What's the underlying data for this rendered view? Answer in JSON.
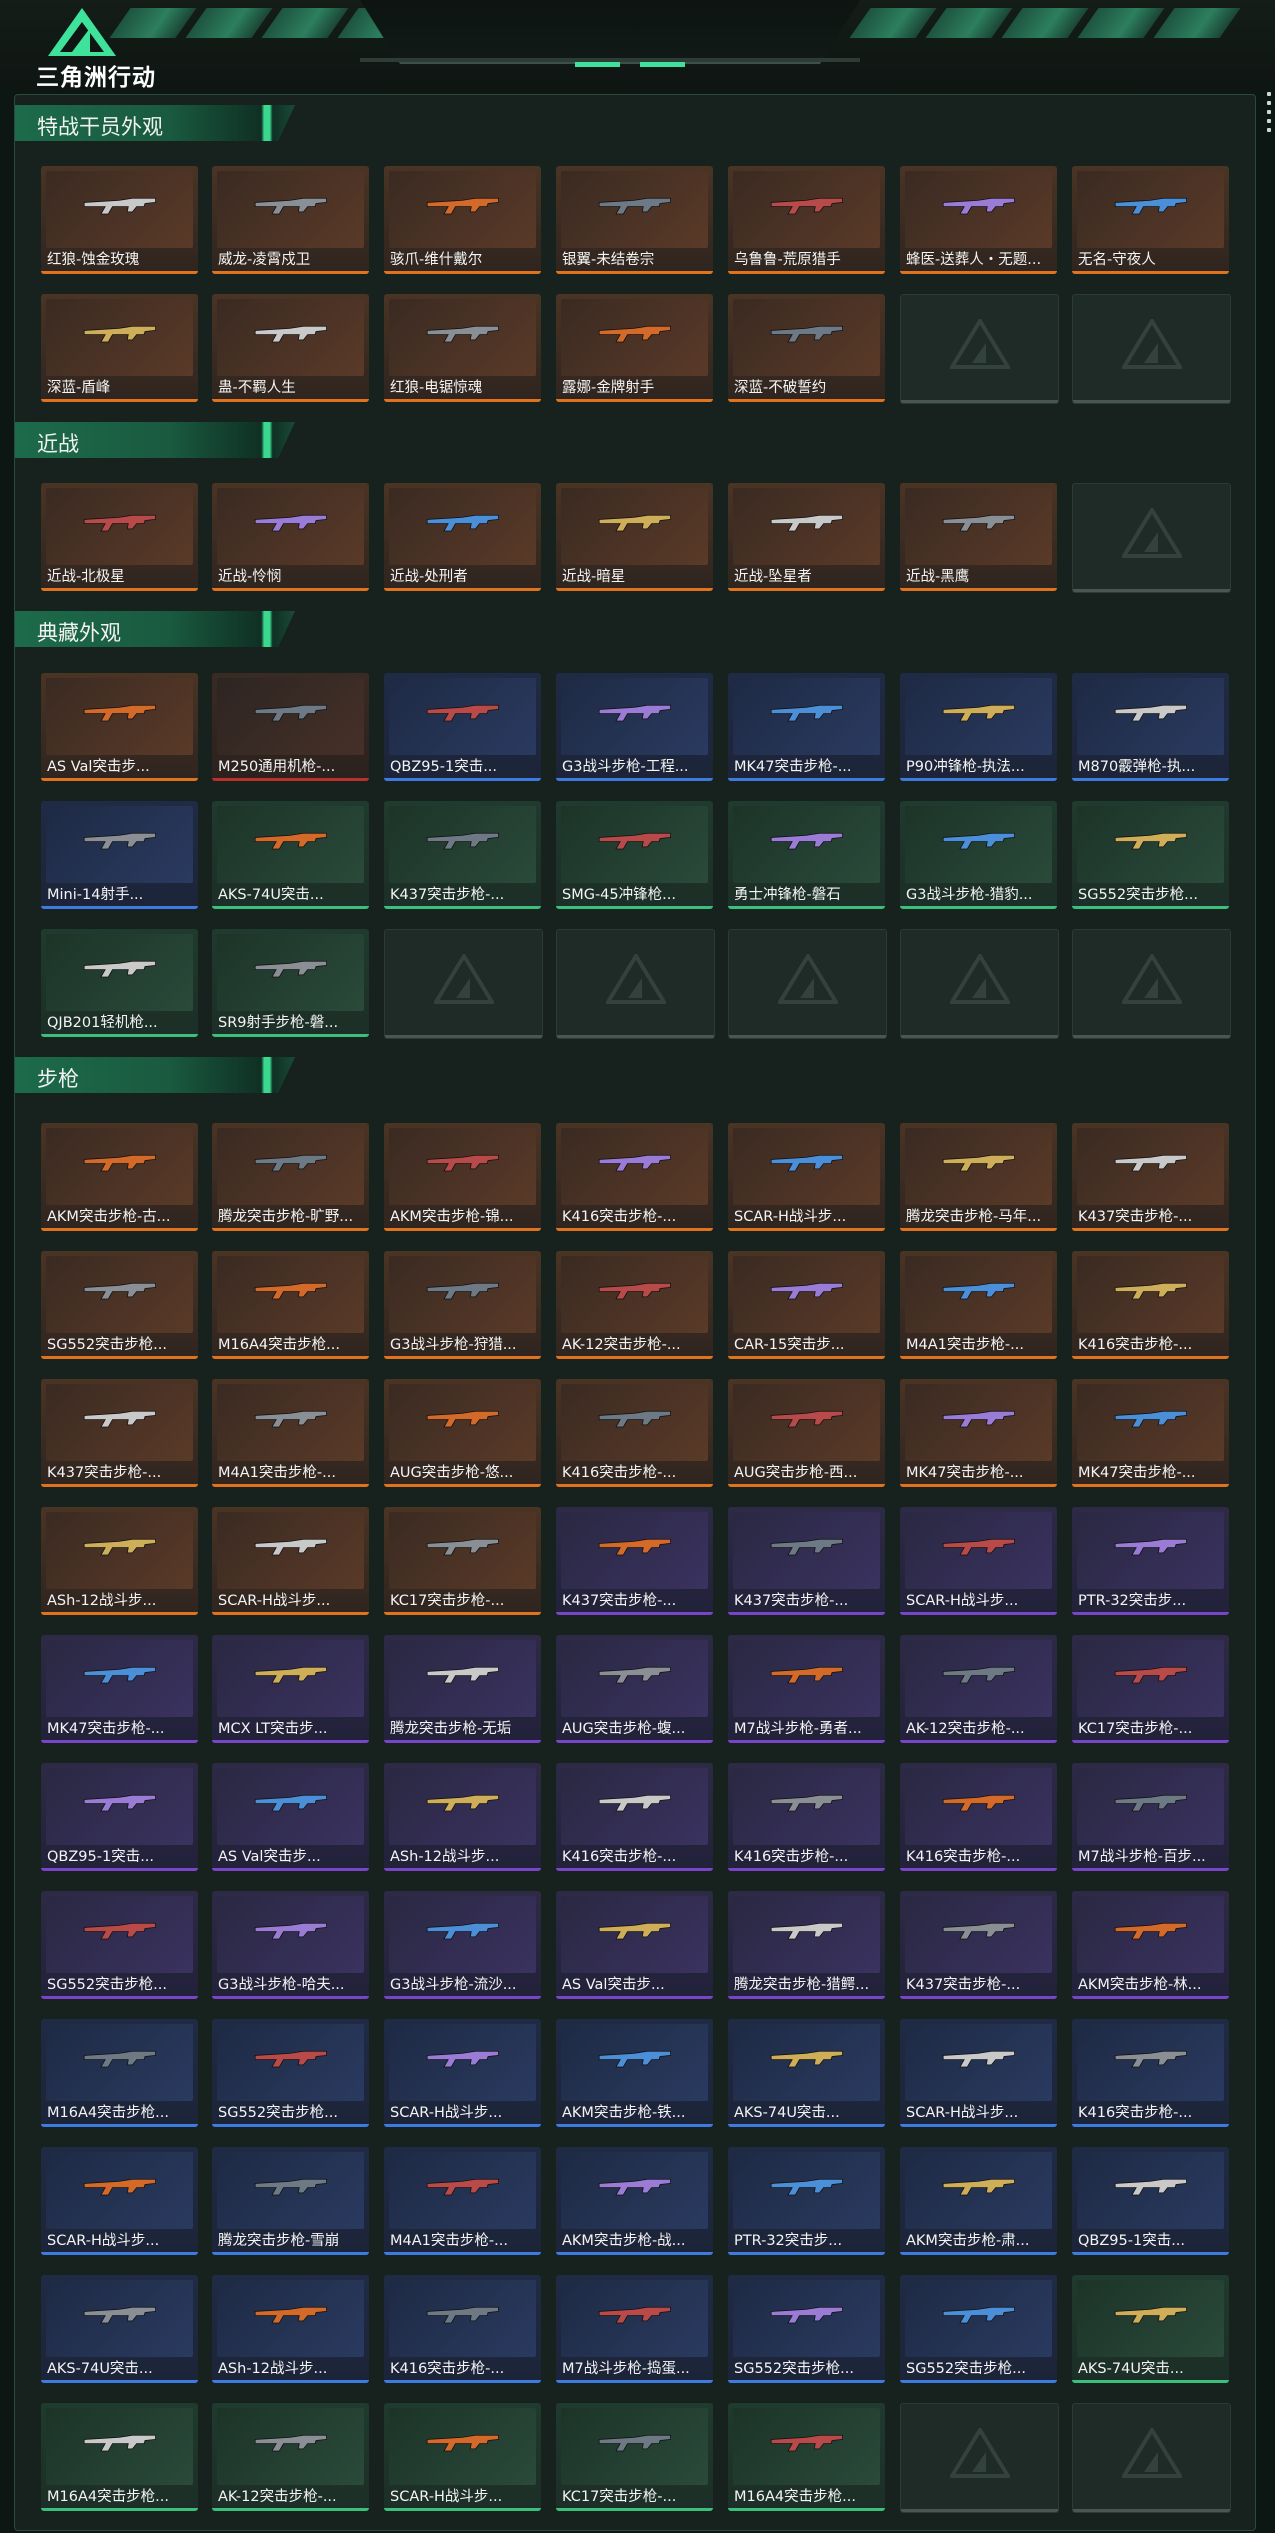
{
  "header": {
    "logo_text": "三角洲行动",
    "logo_icon": "delta-triangle-logo",
    "colors": {
      "accent": "#3ee29a",
      "background": "#0c1612"
    }
  },
  "sections": [
    {
      "title": "特战干员外观",
      "items": [
        {
          "label": "红狼-蚀金玫瑰",
          "rarity": "orange"
        },
        {
          "label": "威龙-凌霄戍卫",
          "rarity": "orange"
        },
        {
          "label": "骇爪-维什戴尔",
          "rarity": "orange"
        },
        {
          "label": "银翼-未结卷宗",
          "rarity": "orange"
        },
        {
          "label": "乌鲁鲁-荒原猎手",
          "rarity": "orange"
        },
        {
          "label": "蜂医-送葬人・无题...",
          "rarity": "orange"
        },
        {
          "label": "无名-守夜人",
          "rarity": "orange"
        },
        {
          "label": "深蓝-盾峰",
          "rarity": "orange"
        },
        {
          "label": "蛊-不羁人生",
          "rarity": "orange"
        },
        {
          "label": "红狼-电锯惊魂",
          "rarity": "orange"
        },
        {
          "label": "露娜-金牌射手",
          "rarity": "orange"
        },
        {
          "label": "深蓝-不破誓约",
          "rarity": "orange"
        },
        {
          "label": "",
          "rarity": "empty"
        },
        {
          "label": "",
          "rarity": "empty"
        }
      ]
    },
    {
      "title": "近战",
      "items": [
        {
          "label": "近战-北极星",
          "rarity": "orange"
        },
        {
          "label": "近战-怜悯",
          "rarity": "orange"
        },
        {
          "label": "近战-处刑者",
          "rarity": "orange"
        },
        {
          "label": "近战-暗星",
          "rarity": "orange"
        },
        {
          "label": "近战-坠星者",
          "rarity": "orange"
        },
        {
          "label": "近战-黑鹰",
          "rarity": "orange"
        },
        {
          "label": "",
          "rarity": "empty"
        }
      ]
    },
    {
      "title": "典藏外观",
      "items": [
        {
          "label": "AS Val突击步...",
          "rarity": "orange"
        },
        {
          "label": "M250通用机枪-...",
          "rarity": "red"
        },
        {
          "label": "QBZ95-1突击...",
          "rarity": "blue"
        },
        {
          "label": "G3战斗步枪-工程...",
          "rarity": "blue"
        },
        {
          "label": "MK47突击步枪-...",
          "rarity": "blue"
        },
        {
          "label": "P90冲锋枪-执法...",
          "rarity": "blue"
        },
        {
          "label": "M870霰弹枪-执...",
          "rarity": "blue"
        },
        {
          "label": "Mini-14射手...",
          "rarity": "blue"
        },
        {
          "label": "AKS-74U突击...",
          "rarity": "green"
        },
        {
          "label": "K437突击步枪-...",
          "rarity": "green"
        },
        {
          "label": "SMG-45冲锋枪...",
          "rarity": "green"
        },
        {
          "label": "勇士冲锋枪-磐石",
          "rarity": "green"
        },
        {
          "label": "G3战斗步枪-猎豹...",
          "rarity": "green"
        },
        {
          "label": "SG552突击步枪...",
          "rarity": "green"
        },
        {
          "label": "QJB201轻机枪...",
          "rarity": "green"
        },
        {
          "label": "SR9射手步枪-磐...",
          "rarity": "green"
        },
        {
          "label": "",
          "rarity": "empty"
        },
        {
          "label": "",
          "rarity": "empty"
        },
        {
          "label": "",
          "rarity": "empty"
        },
        {
          "label": "",
          "rarity": "empty"
        },
        {
          "label": "",
          "rarity": "empty"
        }
      ]
    },
    {
      "title": "步枪",
      "items": [
        {
          "label": "AKM突击步枪-古...",
          "rarity": "orange"
        },
        {
          "label": "腾龙突击步枪-旷野...",
          "rarity": "orange"
        },
        {
          "label": "AKM突击步枪-锦...",
          "rarity": "orange"
        },
        {
          "label": "K416突击步枪-...",
          "rarity": "orange"
        },
        {
          "label": "SCAR-H战斗步...",
          "rarity": "orange"
        },
        {
          "label": "腾龙突击步枪-马年...",
          "rarity": "orange"
        },
        {
          "label": "K437突击步枪-...",
          "rarity": "orange"
        },
        {
          "label": "SG552突击步枪...",
          "rarity": "orange"
        },
        {
          "label": "M16A4突击步枪...",
          "rarity": "orange"
        },
        {
          "label": "G3战斗步枪-狩猎...",
          "rarity": "orange"
        },
        {
          "label": "AK-12突击步枪-...",
          "rarity": "orange"
        },
        {
          "label": "CAR-15突击步...",
          "rarity": "orange"
        },
        {
          "label": "M4A1突击步枪-...",
          "rarity": "orange"
        },
        {
          "label": "K416突击步枪-...",
          "rarity": "orange"
        },
        {
          "label": "K437突击步枪-...",
          "rarity": "orange"
        },
        {
          "label": "M4A1突击步枪-...",
          "rarity": "orange"
        },
        {
          "label": "AUG突击步枪-悠...",
          "rarity": "orange"
        },
        {
          "label": "K416突击步枪-...",
          "rarity": "orange"
        },
        {
          "label": "AUG突击步枪-西...",
          "rarity": "orange"
        },
        {
          "label": "MK47突击步枪-...",
          "rarity": "orange"
        },
        {
          "label": "MK47突击步枪-...",
          "rarity": "orange"
        },
        {
          "label": "ASh-12战斗步...",
          "rarity": "orange"
        },
        {
          "label": "SCAR-H战斗步...",
          "rarity": "orange"
        },
        {
          "label": "KC17突击步枪-...",
          "rarity": "orange"
        },
        {
          "label": "K437突击步枪-...",
          "rarity": "purple"
        },
        {
          "label": "K437突击步枪-...",
          "rarity": "purple"
        },
        {
          "label": "SCAR-H战斗步...",
          "rarity": "purple"
        },
        {
          "label": "PTR-32突击步...",
          "rarity": "purple"
        },
        {
          "label": "MK47突击步枪-...",
          "rarity": "purple"
        },
        {
          "label": "MCX LT突击步...",
          "rarity": "purple"
        },
        {
          "label": "腾龙突击步枪-无垢",
          "rarity": "purple"
        },
        {
          "label": "AUG突击步枪-蝮...",
          "rarity": "purple"
        },
        {
          "label": "M7战斗步枪-勇者...",
          "rarity": "purple"
        },
        {
          "label": "AK-12突击步枪-...",
          "rarity": "purple"
        },
        {
          "label": "KC17突击步枪-...",
          "rarity": "purple"
        },
        {
          "label": "QBZ95-1突击...",
          "rarity": "purple"
        },
        {
          "label": "AS Val突击步...",
          "rarity": "purple"
        },
        {
          "label": "ASh-12战斗步...",
          "rarity": "purple"
        },
        {
          "label": "K416突击步枪-...",
          "rarity": "purple"
        },
        {
          "label": "K416突击步枪-...",
          "rarity": "purple"
        },
        {
          "label": "K416突击步枪-...",
          "rarity": "purple"
        },
        {
          "label": "M7战斗步枪-百步...",
          "rarity": "purple"
        },
        {
          "label": "SG552突击步枪...",
          "rarity": "purple"
        },
        {
          "label": "G3战斗步枪-哈夫...",
          "rarity": "purple"
        },
        {
          "label": "G3战斗步枪-流沙...",
          "rarity": "purple"
        },
        {
          "label": "AS Val突击步...",
          "rarity": "purple"
        },
        {
          "label": "腾龙突击步枪-猎鳄...",
          "rarity": "purple"
        },
        {
          "label": "K437突击步枪-...",
          "rarity": "purple"
        },
        {
          "label": "AKM突击步枪-林...",
          "rarity": "purple"
        },
        {
          "label": "M16A4突击步枪...",
          "rarity": "blue"
        },
        {
          "label": "SG552突击步枪...",
          "rarity": "blue"
        },
        {
          "label": "SCAR-H战斗步...",
          "rarity": "blue"
        },
        {
          "label": "AKM突击步枪-铁...",
          "rarity": "blue"
        },
        {
          "label": "AKS-74U突击...",
          "rarity": "blue"
        },
        {
          "label": "SCAR-H战斗步...",
          "rarity": "blue"
        },
        {
          "label": "K416突击步枪-...",
          "rarity": "blue"
        },
        {
          "label": "SCAR-H战斗步...",
          "rarity": "blue"
        },
        {
          "label": "腾龙突击步枪-雪崩",
          "rarity": "blue"
        },
        {
          "label": "M4A1突击步枪-...",
          "rarity": "blue"
        },
        {
          "label": "AKM突击步枪-战...",
          "rarity": "blue"
        },
        {
          "label": "PTR-32突击步...",
          "rarity": "blue"
        },
        {
          "label": "AKM突击步枪-肃...",
          "rarity": "blue"
        },
        {
          "label": "QBZ95-1突击...",
          "rarity": "blue"
        },
        {
          "label": "AKS-74U突击...",
          "rarity": "blue"
        },
        {
          "label": "ASh-12战斗步...",
          "rarity": "blue"
        },
        {
          "label": "K416突击步枪-...",
          "rarity": "blue"
        },
        {
          "label": "M7战斗步枪-捣蛋...",
          "rarity": "blue"
        },
        {
          "label": "SG552突击步枪...",
          "rarity": "blue"
        },
        {
          "label": "SG552突击步枪...",
          "rarity": "blue"
        },
        {
          "label": "AKS-74U突击...",
          "rarity": "green"
        },
        {
          "label": "M16A4突击步枪...",
          "rarity": "green"
        },
        {
          "label": "AK-12突击步枪-...",
          "rarity": "green"
        },
        {
          "label": "SCAR-H战斗步...",
          "rarity": "green"
        },
        {
          "label": "KC17突击步枪-...",
          "rarity": "green"
        },
        {
          "label": "M16A4突击步枪...",
          "rarity": "green"
        },
        {
          "label": "",
          "rarity": "empty"
        },
        {
          "label": "",
          "rarity": "empty"
        }
      ]
    }
  ]
}
